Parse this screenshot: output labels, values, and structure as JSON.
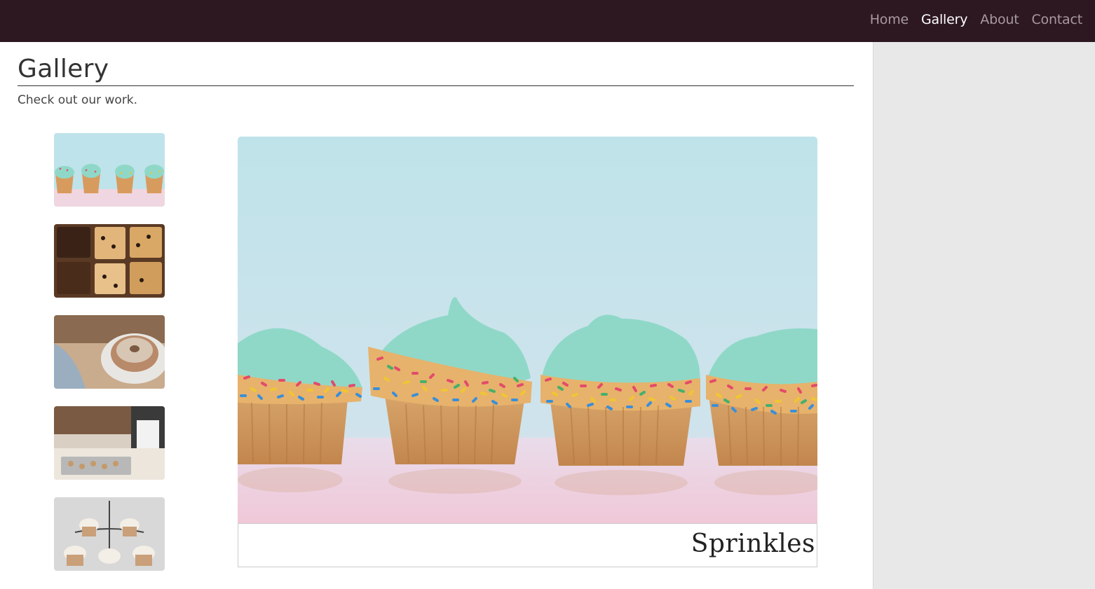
{
  "nav": {
    "links": [
      {
        "label": "Home",
        "active": false
      },
      {
        "label": "Gallery",
        "active": true
      },
      {
        "label": "About",
        "active": false
      },
      {
        "label": "Contact",
        "active": false
      }
    ]
  },
  "page": {
    "title": "Gallery",
    "subtitle": "Check out our work."
  },
  "gallery": {
    "thumbnails": [
      {
        "subject": "cupcakes with sprinkles",
        "selected": true
      },
      {
        "subject": "loaf cakes on tray",
        "selected": false
      },
      {
        "subject": "bundt cake with powdered sugar",
        "selected": false
      },
      {
        "subject": "baker with cookies",
        "selected": false
      },
      {
        "subject": "cupcake stand",
        "selected": false
      }
    ],
    "main_caption": "Sprinkles"
  },
  "colors": {
    "navbar": "#2d1721",
    "nav_inactive": "#a89aa0",
    "nav_active": "#ffffff",
    "sidebar": "#e8e8e8",
    "frosting": "#8fd8c8",
    "sky": "#bfe3ea",
    "table": "#f0d6e0"
  }
}
